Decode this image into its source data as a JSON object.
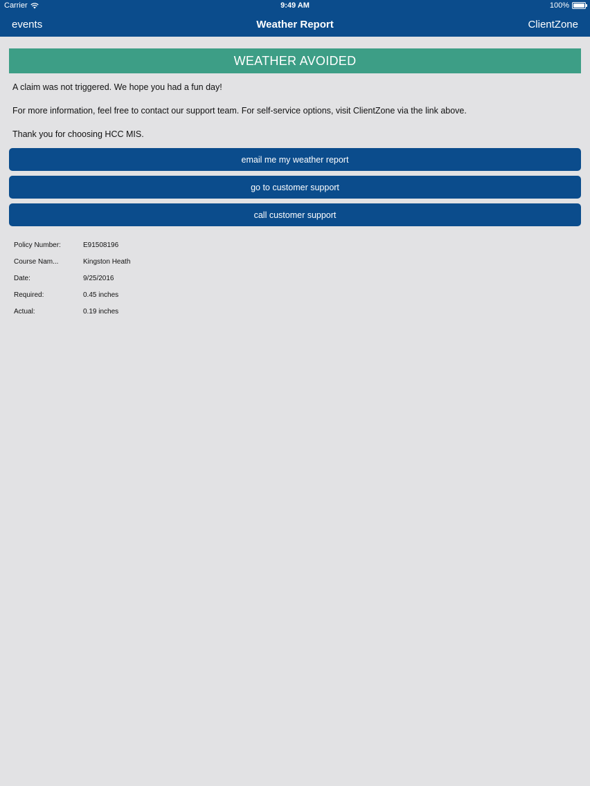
{
  "status_bar": {
    "carrier": "Carrier",
    "time": "9:49 AM",
    "battery": "100%",
    "battery_level": 1.0,
    "icons": [
      "wifi-icon",
      "battery-icon"
    ]
  },
  "nav": {
    "back_label": "events",
    "title": "Weather Report",
    "right_label": "ClientZone"
  },
  "banner": {
    "text": "WEATHER AVOIDED",
    "color": "#3d9e86"
  },
  "messages": {
    "line1": "A claim was not triggered. We hope you had a fun day!",
    "line2": "For more information, feel free to contact our support team. For self-service options, visit ClientZone via the link above.",
    "line3": "Thank you for choosing HCC MIS."
  },
  "buttons": {
    "email": "email me my weather report",
    "support": "go to customer support",
    "call": "call customer support"
  },
  "details": [
    {
      "label": "Policy Number:",
      "value": "E91508196"
    },
    {
      "label": "Course Nam...",
      "value": "Kingston Heath"
    },
    {
      "label": "Date:",
      "value": "9/25/2016"
    },
    {
      "label": "Required:",
      "value": "0.45 inches"
    },
    {
      "label": "Actual:",
      "value": "0.19 inches"
    }
  ],
  "colors": {
    "primary": "#0b4c8c",
    "background": "#e2e2e4"
  }
}
